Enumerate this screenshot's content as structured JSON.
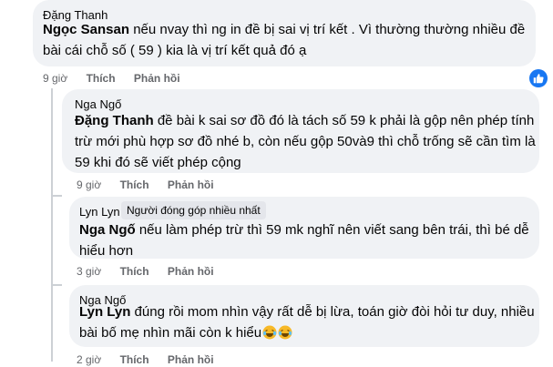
{
  "comments": [
    {
      "author": "Đặng Thanh",
      "mention": "Ngọc Sansan",
      "text": " nếu nvay thì ng in đề bị sai vị trí kết . Vì thường thường nhiều đề bài cái chỗ số ( 59 ) kia là vị trí kết quả đó ạ",
      "time": "9 giờ",
      "like_label": "Thích",
      "reply_label": "Phản hồi",
      "reaction": "like-icon"
    },
    {
      "author": "Nga Ngố",
      "mention": "Đặng Thanh",
      "text": " đề bài k sai sơ đồ đó là tách số 59 k phải là gộp nên phép tính trừ mới phù hợp sơ đồ nhé b, còn nếu gộp 50và9 thì chỗ trống sẽ cần tìm là 59 khi đó sẽ viết phép cộng",
      "time": "9 giờ",
      "like_label": "Thích",
      "reply_label": "Phản hồi"
    },
    {
      "author": "Lyn Lyn",
      "badge": "Người đóng góp nhiều nhất",
      "mention": "Nga Ngố",
      "text": " nếu làm phép trừ thì 59 mk nghĩ nên viết sang bên trái, thì bé dễ hiểu hơn",
      "time": "3 giờ",
      "like_label": "Thích",
      "reply_label": "Phản hồi"
    },
    {
      "author": "Nga Ngố",
      "mention": "Lyn Lyn",
      "text": " đúng rồi mom nhìn vậy rất dễ bị lừa, toán giờ đòi hỏi tư duy, nhiều bài bố mẹ nhìn mãi còn k hiểu",
      "emojis": [
        "laughing-tears-emoji",
        "laughing-tears-emoji"
      ],
      "time": "2 giờ",
      "like_label": "Thích",
      "reply_label": "Phản hồi"
    }
  ],
  "colors": {
    "bubble": "#f0f2f5",
    "meta": "#65676b",
    "like": "#1877f2",
    "badge": "#e4e6eb",
    "thread": "#ccd0d5"
  }
}
